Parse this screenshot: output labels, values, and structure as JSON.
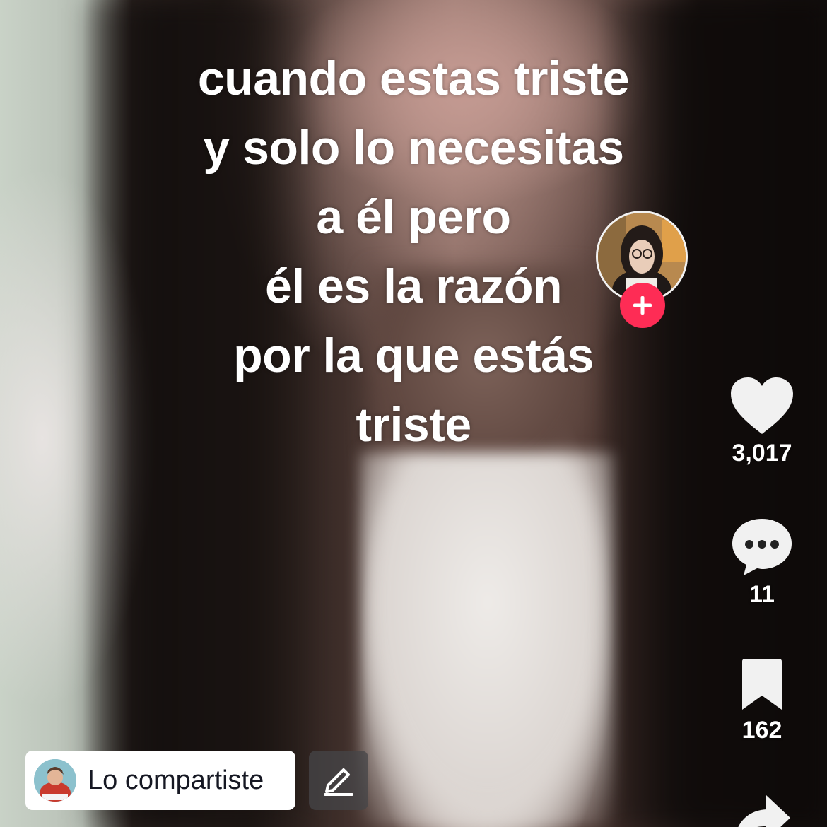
{
  "video": {
    "caption_lines": [
      "cuando estas triste",
      "y solo lo necesitas",
      "a él pero",
      "él es la razón",
      "por la que estás",
      "triste"
    ]
  },
  "side_rail": {
    "creator_avatar_icon": "profile-photo",
    "follow_icon": "plus-icon",
    "follow_color": "#fe2c55",
    "likes": {
      "icon": "heart-icon",
      "count": "3,017"
    },
    "comments": {
      "icon": "speech-bubble-icon",
      "count": "11"
    },
    "saves": {
      "icon": "bookmark-icon",
      "count": "162"
    },
    "share": {
      "icon": "share-arrow-icon"
    }
  },
  "bottom_bar": {
    "shared_chip": {
      "label": "Lo compartiste",
      "avatar_icon": "user-avatar"
    },
    "edit_button": {
      "icon": "pencil-icon"
    }
  }
}
